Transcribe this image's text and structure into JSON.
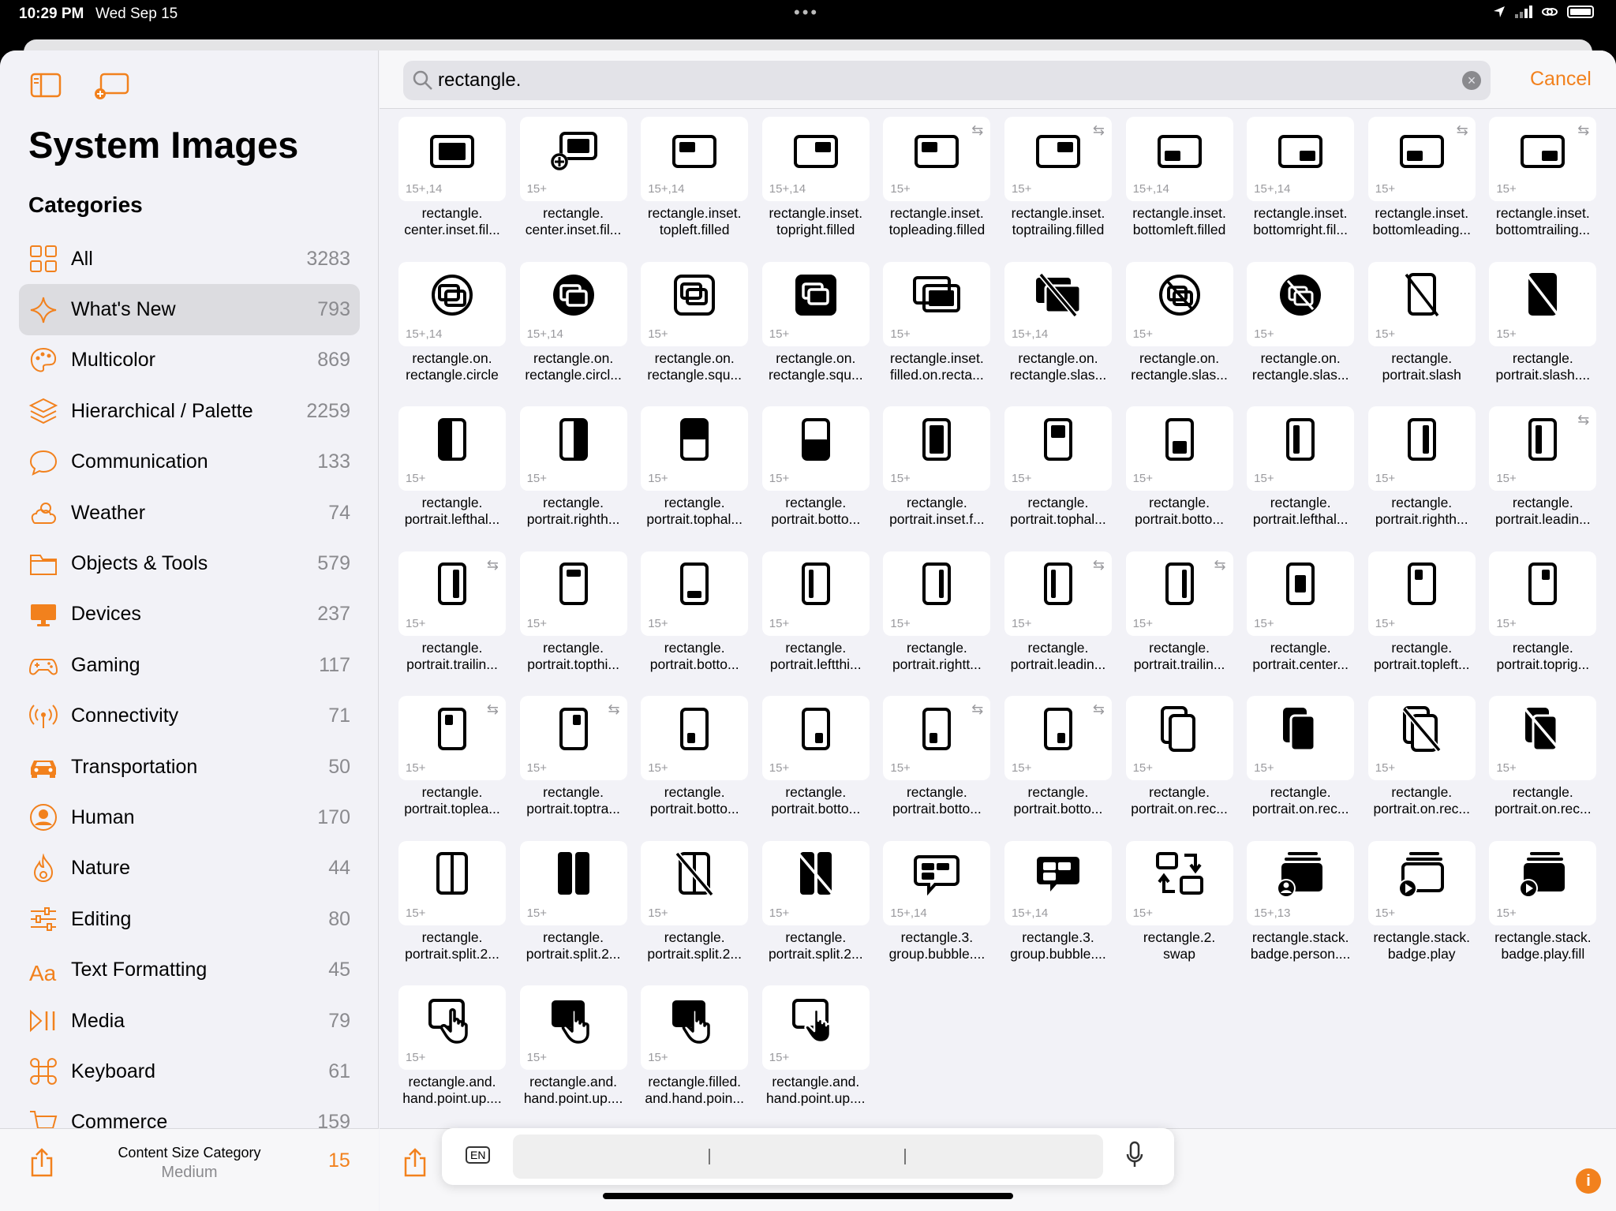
{
  "status": {
    "time": "10:29 PM",
    "date": "Wed Sep 15",
    "dots": "•••"
  },
  "sidebar": {
    "title": "System Images",
    "categories_title": "Categories",
    "categories": [
      {
        "icon": "grid-icon",
        "label": "All",
        "count": "3283"
      },
      {
        "icon": "sparkles-icon",
        "label": "What's New",
        "count": "793",
        "selected": true
      },
      {
        "icon": "palette-icon",
        "label": "Multicolor",
        "count": "869"
      },
      {
        "icon": "layers-icon",
        "label": "Hierarchical / Palette",
        "count": "2259"
      },
      {
        "icon": "bubble-icon",
        "label": "Communication",
        "count": "133"
      },
      {
        "icon": "cloud-sun-icon",
        "label": "Weather",
        "count": "74"
      },
      {
        "icon": "folder-icon",
        "label": "Objects & Tools",
        "count": "579"
      },
      {
        "icon": "display-icon",
        "label": "Devices",
        "count": "237"
      },
      {
        "icon": "gamecontroller-icon",
        "label": "Gaming",
        "count": "117"
      },
      {
        "icon": "antenna-icon",
        "label": "Connectivity",
        "count": "71"
      },
      {
        "icon": "car-icon",
        "label": "Transportation",
        "count": "50"
      },
      {
        "icon": "person-circle-icon",
        "label": "Human",
        "count": "170"
      },
      {
        "icon": "flame-icon",
        "label": "Nature",
        "count": "44"
      },
      {
        "icon": "sliders-icon",
        "label": "Editing",
        "count": "80"
      },
      {
        "icon": "textformat-icon",
        "label": "Text Formatting",
        "count": "45"
      },
      {
        "icon": "playpause-icon",
        "label": "Media",
        "count": "79"
      },
      {
        "icon": "command-icon",
        "label": "Keyboard",
        "count": "61"
      },
      {
        "icon": "cart-icon",
        "label": "Commerce",
        "count": "159"
      }
    ],
    "content_size_label": "Content Size Category",
    "content_size_value": "Medium",
    "content_size_number": "15"
  },
  "search": {
    "value": "rectangle.",
    "cancel": "Cancel",
    "clear": "×"
  },
  "keyboard_bar": {
    "lang": "EN"
  },
  "info_label": "i",
  "symbols": [
    {
      "name": "rectangle.\ncenter.inset.fil...",
      "ver": "15+,14",
      "glyph": "r-center"
    },
    {
      "name": "rectangle.\ncenter.inset.fil...",
      "ver": "15+",
      "glyph": "r-center-plus"
    },
    {
      "name": "rectangle.inset.\ntopleft.filled",
      "ver": "15+,14",
      "glyph": "r-tl"
    },
    {
      "name": "rectangle.inset.\ntopright.filled",
      "ver": "15+,14",
      "glyph": "r-tr"
    },
    {
      "name": "rectangle.inset.\ntopleading.filled",
      "ver": "15+",
      "glyph": "r-tl",
      "rtl": true
    },
    {
      "name": "rectangle.inset.\ntoptrailing.filled",
      "ver": "15+",
      "glyph": "r-tr",
      "rtl": true
    },
    {
      "name": "rectangle.inset.\nbottomleft.filled",
      "ver": "15+,14",
      "glyph": "r-bl"
    },
    {
      "name": "rectangle.inset.\nbottomright.fil...",
      "ver": "15+,14",
      "glyph": "r-br"
    },
    {
      "name": "rectangle.inset.\nbottomleading...",
      "ver": "15+",
      "glyph": "r-bl",
      "rtl": true
    },
    {
      "name": "rectangle.inset.\nbottomtrailing...",
      "ver": "15+",
      "glyph": "r-br",
      "rtl": true
    },
    {
      "name": "rectangle.on.\nrectangle.circle",
      "ver": "15+,14",
      "glyph": "circle-rr"
    },
    {
      "name": "rectangle.on.\nrectangle.circl...",
      "ver": "15+,14",
      "glyph": "circle-rr-fill"
    },
    {
      "name": "rectangle.on.\nrectangle.squ...",
      "ver": "15+",
      "glyph": "square-rr"
    },
    {
      "name": "rectangle.on.\nrectangle.squ...",
      "ver": "15+",
      "glyph": "square-rr-fill"
    },
    {
      "name": "rectangle.inset.\nfilled.on.recta...",
      "ver": "15+",
      "glyph": "rr-inset"
    },
    {
      "name": "rectangle.on.\nrectangle.slas...",
      "ver": "15+,14",
      "glyph": "rr-slash"
    },
    {
      "name": "rectangle.on.\nrectangle.slas...",
      "ver": "15+",
      "glyph": "circle-rr-slash"
    },
    {
      "name": "rectangle.on.\nrectangle.slas...",
      "ver": "15+",
      "glyph": "circle-rr-slash-fill"
    },
    {
      "name": "rectangle.\nportrait.slash",
      "ver": "15+",
      "glyph": "p-slash"
    },
    {
      "name": "rectangle.\nportrait.slash....",
      "ver": "15+",
      "glyph": "p-slash-fill"
    },
    {
      "name": "rectangle.\nportrait.lefthal...",
      "ver": "15+",
      "glyph": "p-lefthalf"
    },
    {
      "name": "rectangle.\nportrait.righth...",
      "ver": "15+",
      "glyph": "p-righthalf"
    },
    {
      "name": "rectangle.\nportrait.tophal...",
      "ver": "15+",
      "glyph": "p-tophalf"
    },
    {
      "name": "rectangle.\nportrait.botto...",
      "ver": "15+",
      "glyph": "p-bottomhalf"
    },
    {
      "name": "rectangle.\nportrait.inset.f...",
      "ver": "15+",
      "glyph": "p-inset"
    },
    {
      "name": "rectangle.\nportrait.tophal...",
      "ver": "15+",
      "glyph": "p-tophalf-inset"
    },
    {
      "name": "rectangle.\nportrait.botto...",
      "ver": "15+",
      "glyph": "p-bottomhalf-inset"
    },
    {
      "name": "rectangle.\nportrait.lefthal...",
      "ver": "15+",
      "glyph": "p-lefthalf-inset"
    },
    {
      "name": "rectangle.\nportrait.righth...",
      "ver": "15+",
      "glyph": "p-righthalf-inset"
    },
    {
      "name": "rectangle.\nportrait.leadin...",
      "ver": "15+",
      "glyph": "p-lefthalf-inset",
      "rtl": true
    },
    {
      "name": "rectangle.\nportrait.trailin...",
      "ver": "15+",
      "glyph": "p-righthalf-inset",
      "rtl": true
    },
    {
      "name": "rectangle.\nportrait.topthi...",
      "ver": "15+",
      "glyph": "p-topthird"
    },
    {
      "name": "rectangle.\nportrait.botto...",
      "ver": "15+",
      "glyph": "p-bottomthird"
    },
    {
      "name": "rectangle.\nportrait.leftthi...",
      "ver": "15+",
      "glyph": "p-leftthird"
    },
    {
      "name": "rectangle.\nportrait.rightt...",
      "ver": "15+",
      "glyph": "p-rightthird"
    },
    {
      "name": "rectangle.\nportrait.leadin...",
      "ver": "15+",
      "glyph": "p-leftthird",
      "rtl": true
    },
    {
      "name": "rectangle.\nportrait.trailin...",
      "ver": "15+",
      "glyph": "p-rightthird",
      "rtl": true
    },
    {
      "name": "rectangle.\nportrait.center...",
      "ver": "15+",
      "glyph": "p-center"
    },
    {
      "name": "rectangle.\nportrait.topleft...",
      "ver": "15+",
      "glyph": "p-tl"
    },
    {
      "name": "rectangle.\nportrait.toprig...",
      "ver": "15+",
      "glyph": "p-tr"
    },
    {
      "name": "rectangle.\nportrait.toplea...",
      "ver": "15+",
      "glyph": "p-tl",
      "rtl": true
    },
    {
      "name": "rectangle.\nportrait.toptra...",
      "ver": "15+",
      "glyph": "p-tr",
      "rtl": true
    },
    {
      "name": "rectangle.\nportrait.botto...",
      "ver": "15+",
      "glyph": "p-bl"
    },
    {
      "name": "rectangle.\nportrait.botto...",
      "ver": "15+",
      "glyph": "p-br"
    },
    {
      "name": "rectangle.\nportrait.botto...",
      "ver": "15+",
      "glyph": "p-bl",
      "rtl": true
    },
    {
      "name": "rectangle.\nportrait.botto...",
      "ver": "15+",
      "glyph": "p-br",
      "rtl": true
    },
    {
      "name": "rectangle.\nportrait.on.rec...",
      "ver": "15+",
      "glyph": "pp"
    },
    {
      "name": "rectangle.\nportrait.on.rec...",
      "ver": "15+",
      "glyph": "pp-fill"
    },
    {
      "name": "rectangle.\nportrait.on.rec...",
      "ver": "15+",
      "glyph": "pp-slash"
    },
    {
      "name": "rectangle.\nportrait.on.rec...",
      "ver": "15+",
      "glyph": "pp-slash-fill"
    },
    {
      "name": "rectangle.\nportrait.split.2...",
      "ver": "15+",
      "glyph": "p-split"
    },
    {
      "name": "rectangle.\nportrait.split.2...",
      "ver": "15+",
      "glyph": "p-split-fill"
    },
    {
      "name": "rectangle.\nportrait.split.2...",
      "ver": "15+",
      "glyph": "p-split-slash"
    },
    {
      "name": "rectangle.\nportrait.split.2...",
      "ver": "15+",
      "glyph": "p-split-slash-fill"
    },
    {
      "name": "rectangle.3.\ngroup.bubble....",
      "ver": "15+,14",
      "glyph": "bubble3"
    },
    {
      "name": "rectangle.3.\ngroup.bubble....",
      "ver": "15+,14",
      "glyph": "bubble3-fill"
    },
    {
      "name": "rectangle.2.\nswap",
      "ver": "15+",
      "glyph": "swap"
    },
    {
      "name": "rectangle.stack.\nbadge.person....",
      "ver": "15+,13",
      "glyph": "stack-person"
    },
    {
      "name": "rectangle.stack.\nbadge.play",
      "ver": "15+",
      "glyph": "stack-play"
    },
    {
      "name": "rectangle.stack.\nbadge.play.fill",
      "ver": "15+",
      "glyph": "stack-play-fill"
    },
    {
      "name": "rectangle.and.\nhand.point.up....",
      "ver": "15+",
      "glyph": "hand"
    },
    {
      "name": "rectangle.and.\nhand.point.up....",
      "ver": "15+",
      "glyph": "hand-fill"
    },
    {
      "name": "rectangle.filled.\nand.hand.poin...",
      "ver": "15+",
      "glyph": "hand-fill2"
    },
    {
      "name": "rectangle.and.\nhand.point.up....",
      "ver": "15+",
      "glyph": "hand-fill3"
    }
  ]
}
